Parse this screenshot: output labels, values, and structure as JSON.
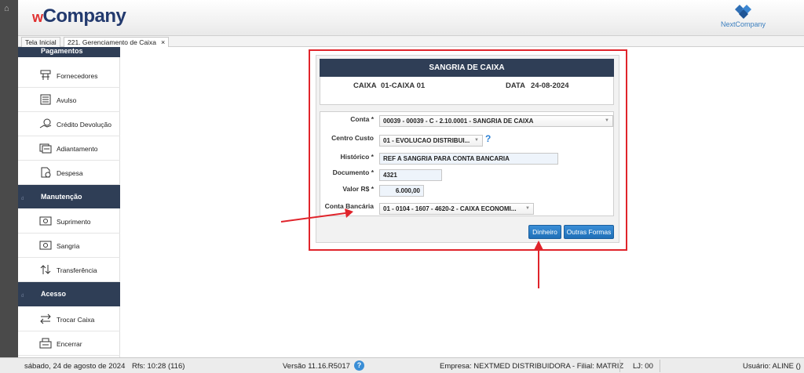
{
  "header": {
    "brand_w": "w",
    "brand_rest": "Company",
    "partner_logo_text": "NextCompany"
  },
  "tabs": [
    {
      "label": "Tela Inicial",
      "active": false
    },
    {
      "label": "221. Gerenciamento de Caixa",
      "active": true,
      "close": "×"
    }
  ],
  "sidebar": {
    "sections": [
      {
        "title": "Pagamentos",
        "items": [
          {
            "label": "Fornecedores",
            "icon": "supplier-icon"
          },
          {
            "label": "Avulso",
            "icon": "ledger-icon"
          },
          {
            "label": "Crédito Devolução",
            "icon": "refund-icon"
          },
          {
            "label": "Adiantamento",
            "icon": "advance-icon"
          },
          {
            "label": "Despesa",
            "icon": "expense-icon"
          }
        ]
      },
      {
        "title": "Manutenção",
        "items": [
          {
            "label": "Suprimento",
            "icon": "cash-in-icon"
          },
          {
            "label": "Sangria",
            "icon": "cash-out-icon"
          },
          {
            "label": "Transferência",
            "icon": "transfer-icon"
          }
        ]
      },
      {
        "title": "Acesso",
        "items": [
          {
            "label": "Trocar Caixa",
            "icon": "swap-icon"
          },
          {
            "label": "Encerrar",
            "icon": "register-icon"
          }
        ]
      }
    ]
  },
  "form": {
    "title": "SANGRIA DE CAIXA",
    "caixa_label": "CAIXA",
    "caixa_value": "01-CAIXA 01",
    "data_label": "DATA",
    "data_value": "24-08-2024",
    "fields": {
      "conta": {
        "label": "Conta *",
        "value": "00039 - 00039 - C - 2.10.0001 - SANGRIA DE CAIXA"
      },
      "centro_custo": {
        "label": "Centro Custo",
        "value": "01 - EVOLUCAO DISTRIBUI..."
      },
      "historico": {
        "label": "Histórico *",
        "value": "REF A SANGRIA PARA CONTA BANCARIA"
      },
      "documento": {
        "label": "Documento *",
        "value": "4321"
      },
      "valor": {
        "label": "Valor R$ *",
        "value": "6.000,00"
      },
      "conta_bancaria": {
        "label": "Conta Bancária",
        "value": "01 - 0104 - 1607 - 4620-2 - CAIXA ECONOMI..."
      }
    },
    "help_glyph": "?",
    "buttons": {
      "dinheiro": "Dinheiro",
      "outras_formas": "Outras Formas"
    }
  },
  "status": {
    "date": "sábado, 24 de agosto de 2024",
    "rfs": "Rfs: 10:28 (116)",
    "version": "Versão 11.16.R5017",
    "help_glyph": "?",
    "empresa": "Empresa: NEXTMED DISTRIBUIDORA - Filial: MATRIZ",
    "lj": "LJ: 00",
    "usuario": "Usuário: ALINE ()"
  },
  "colors": {
    "nav_dark": "#2f3e56",
    "highlight_red": "#e0242b",
    "button_blue": "#2a7fd4",
    "brand_navy": "#233a6e"
  }
}
